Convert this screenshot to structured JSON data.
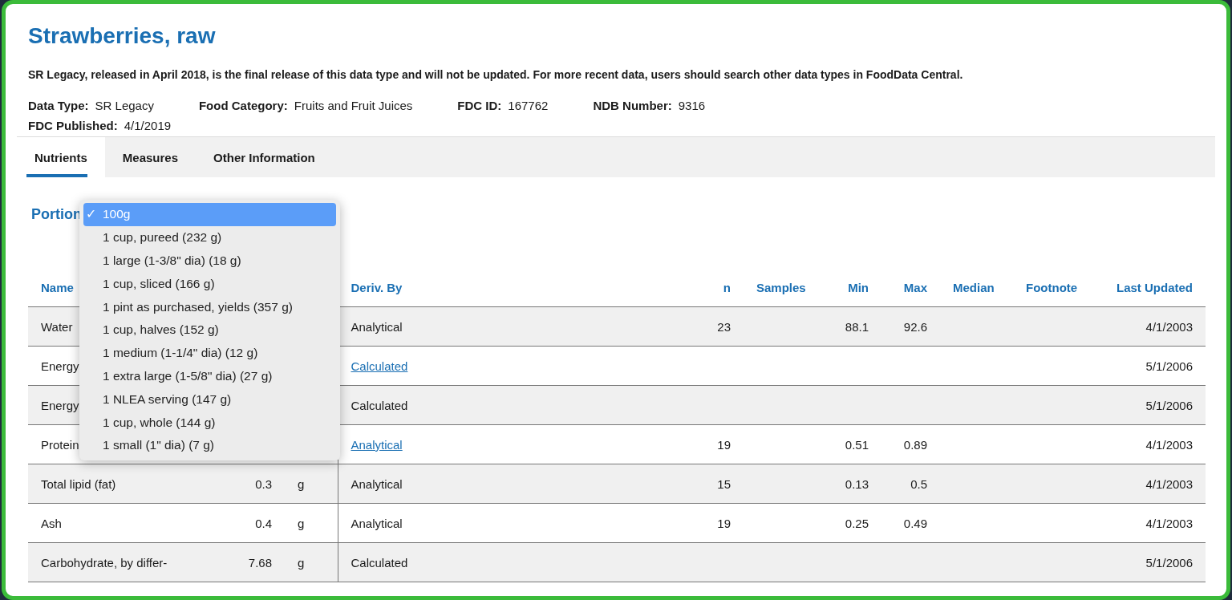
{
  "title": "Strawberries, raw",
  "notice": "SR Legacy, released in April 2018, is the final release of this data type and will not be updated. For more recent data, users should search other data types in FoodData Central.",
  "meta": [
    {
      "label": "Data Type:",
      "value": "SR Legacy"
    },
    {
      "label": "Food Category:",
      "value": "Fruits and Fruit Juices"
    },
    {
      "label": "FDC ID:",
      "value": "167762"
    },
    {
      "label": "NDB Number:",
      "value": "9316"
    },
    {
      "label": "FDC Published:",
      "value": "4/1/2019"
    }
  ],
  "tabs": [
    {
      "label": "Nutrients",
      "selected": true
    },
    {
      "label": "Measures",
      "selected": false
    },
    {
      "label": "Other Information",
      "selected": false
    }
  ],
  "portion": {
    "label": "Portion",
    "check_mark": "✓",
    "options": [
      {
        "label": "100g",
        "selected": true
      },
      {
        "label": "1 cup, pureed (232 g)",
        "selected": false
      },
      {
        "label": "1 large (1-3/8\" dia) (18 g)",
        "selected": false
      },
      {
        "label": "1 cup, sliced (166 g)",
        "selected": false
      },
      {
        "label": "1 pint as purchased, yields (357 g)",
        "selected": false
      },
      {
        "label": "1 cup, halves (152 g)",
        "selected": false
      },
      {
        "label": "1 medium (1-1/4\" dia) (12 g)",
        "selected": false
      },
      {
        "label": "1 extra large (1-5/8\" dia) (27 g)",
        "selected": false
      },
      {
        "label": "1 NLEA serving (147 g)",
        "selected": false
      },
      {
        "label": "1 cup, whole (144 g)",
        "selected": false
      },
      {
        "label": "1 small (1\" dia) (7 g)",
        "selected": false
      }
    ]
  },
  "table": {
    "columns": [
      "Name",
      "Deriv. By",
      "n",
      "Samples",
      "Min",
      "Max",
      "Median",
      "Footnote",
      "Last Updated"
    ],
    "rows": [
      {
        "name": "Water",
        "deriv_by": "Analytical",
        "deriv_link": false,
        "n": "23",
        "min": "88.1",
        "max": "92.6",
        "last_updated": "4/1/2003"
      },
      {
        "name": "Energy",
        "deriv_by": "Calculated",
        "deriv_link": true,
        "last_updated": "5/1/2006"
      },
      {
        "name": "Energy",
        "deriv_by": "Calculated",
        "deriv_link": false,
        "last_updated": "5/1/2006"
      },
      {
        "name": "Protein",
        "deriv_by": "Analytical",
        "deriv_link": true,
        "n": "19",
        "min": "0.51",
        "max": "0.89",
        "last_updated": "4/1/2003"
      },
      {
        "name": "Total lipid (fat)",
        "amount": "0.3",
        "unit": "g",
        "deriv_by": "Analytical",
        "deriv_link": false,
        "n": "15",
        "min": "0.13",
        "max": "0.5",
        "last_updated": "4/1/2003"
      },
      {
        "name": "Ash",
        "amount": "0.4",
        "unit": "g",
        "deriv_by": "Analytical",
        "deriv_link": false,
        "n": "19",
        "min": "0.25",
        "max": "0.49",
        "last_updated": "4/1/2003"
      },
      {
        "name": "Carbohydrate, by differ-",
        "amount": "7.68",
        "unit": "g",
        "deriv_by": "Calculated",
        "deriv_link": false,
        "last_updated": "5/1/2006"
      }
    ]
  }
}
